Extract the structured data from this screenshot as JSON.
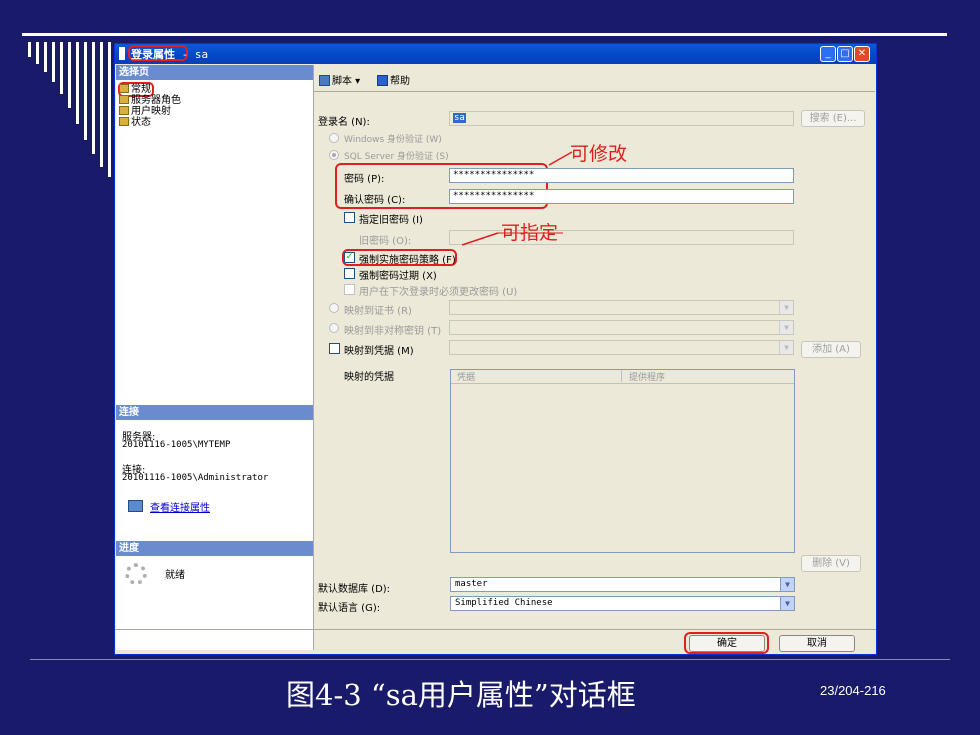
{
  "window": {
    "title": "登录属性",
    "title_suffix": " - sa"
  },
  "left": {
    "select_page": "选择页",
    "nav": [
      "常规",
      "服务器角色",
      "用户映射",
      "状态"
    ],
    "connection_header": "连接",
    "server_label": "服务器:",
    "server_value": "20101116-1005\\MYTEMP",
    "connect_label": "连接:",
    "connect_value": "20101116-1005\\Administrator",
    "view_link": "查看连接属性",
    "progress_header": "进度",
    "progress_status": "就绪"
  },
  "toolbar": {
    "script": "脚本",
    "help": "帮助"
  },
  "form": {
    "login_name_label": "登录名 (N):",
    "login_name_value": "sa",
    "search_button": "搜索 (E)...",
    "windows_auth": "Windows 身份验证 (W)",
    "sql_auth": "SQL Server 身份验证 (S)",
    "password_label": "密码 (P):",
    "password_value": "***************",
    "confirm_label": "确认密码 (C):",
    "confirm_value": "***************",
    "specify_old": "指定旧密码 (I)",
    "old_password": "旧密码 (O):",
    "enforce_policy": "强制实施密码策略 (F)",
    "enforce_expiration": "强制密码过期 (X)",
    "must_change": "用户在下次登录时必须更改密码 (U)",
    "map_cert": "映射到证书 (R)",
    "map_asym": "映射到非对称密钥 (T)",
    "map_cred": "映射到凭据 (M)",
    "add_button": "添加 (A)",
    "mapped_creds": "映射的凭据",
    "col_credential": "凭据",
    "col_provider": "提供程序",
    "remove_button": "删除 (V)",
    "default_db_label": "默认数据库 (D):",
    "default_db_value": "master",
    "default_lang_label": "默认语言 (G):",
    "default_lang_value": "Simplified Chinese"
  },
  "buttons": {
    "ok": "确定",
    "cancel": "取消"
  },
  "annotations": {
    "modifiable": "可修改",
    "specifiable": "可指定"
  },
  "caption": "图4-3 “sa用户属性”对话框",
  "page_number": "23/204-216"
}
